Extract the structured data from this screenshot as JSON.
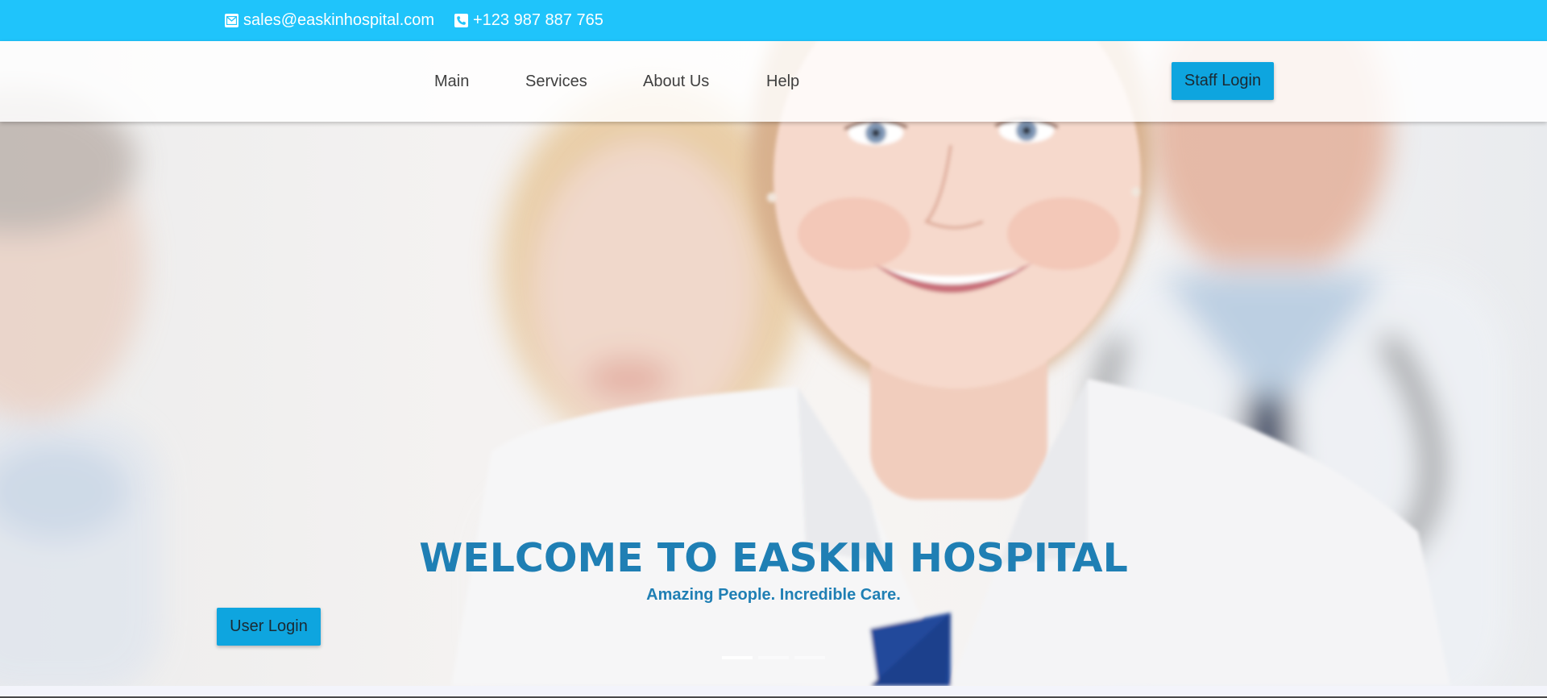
{
  "topbar": {
    "email": "sales@easkinhospital.com",
    "phone": "+123 987 887 765",
    "background": "#1fc4fb"
  },
  "nav": {
    "items": [
      {
        "label": "Main"
      },
      {
        "label": "Services"
      },
      {
        "label": "About Us"
      },
      {
        "label": "Help"
      }
    ],
    "staff_login_label": "Staff Login"
  },
  "hero": {
    "title": "WELCOME TO EASKIN HOSPITAL",
    "subtitle": "Amazing People. Incredible Care.",
    "user_login_label": "User Login",
    "slide_count": 3,
    "active_slide": 1,
    "title_color": "#1f7fb4"
  },
  "colors": {
    "accent": "#0ea5df",
    "topbar": "#1fc4fb"
  },
  "icons": {
    "email": "envelope-icon",
    "phone": "phone-icon"
  }
}
